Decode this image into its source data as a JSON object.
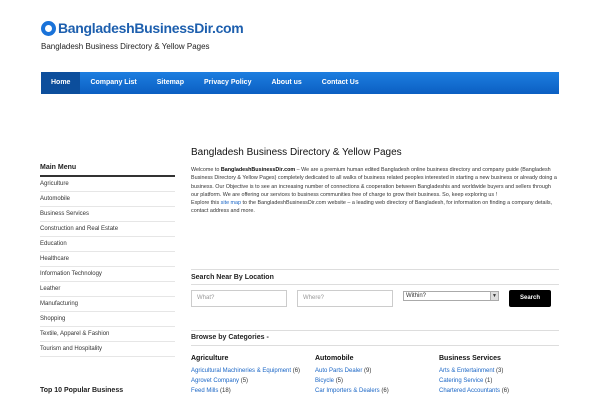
{
  "header": {
    "logo_text": "BangladeshBusinessDir.com",
    "tagline": "Bangladesh Business Directory & Yellow Pages"
  },
  "nav": [
    {
      "label": "Home",
      "active": true
    },
    {
      "label": "Company List"
    },
    {
      "label": "Sitemap"
    },
    {
      "label": "Privacy Policy"
    },
    {
      "label": "About us"
    },
    {
      "label": "Contact Us"
    }
  ],
  "sidebar": {
    "title": "Main Menu",
    "items": [
      "Agriculture",
      "Automobile",
      "Business Services",
      "Construction and Real Estate",
      "Education",
      "Healthcare",
      "Information Technology",
      "Leather",
      "Manufacturing",
      "Shopping",
      "Textile, Apparel & Fashion",
      "Tourism and Hospitality"
    ],
    "title2": "Top 10 Popular Business"
  },
  "main": {
    "title": "Bangladesh Business Directory & Yellow Pages",
    "intro": {
      "p1_a": "Welcome to ",
      "p1_b": "BangladeshBusinessDir.com",
      "p1_c": " – We are a premium human edited Bangladesh online business directory and company guide (Bangladesh Business Directory & Yellow Pages) completely dedicated to all walks of business related peoples interested in starting a new business or already doing a business. Our Objective is to see an increasing number of connections & cooperation between Bangladeshis and worldwide buyers and sellers through our platform. We are offering our services to business communities free of charge to grow their business. So, keep exploring us !",
      "p2_a": "Explore this ",
      "p2_link": "site map",
      "p2_b": " to the BangladeshBusinessDir.com website – a leading web directory of Bangladesh, for information on finding a company details, contact address and more."
    }
  },
  "search": {
    "heading": "Search Near By Location",
    "what_placeholder": "What?",
    "where_placeholder": "Where?",
    "within_value": "Within?",
    "button": "Search"
  },
  "browse": {
    "heading": "Browse by Categories -",
    "columns": [
      {
        "title": "Agriculture",
        "links": [
          {
            "name": "Agricultural Machineries & Equipment",
            "count": "(6)"
          },
          {
            "name": "Agrovet Company",
            "count": "(5)"
          },
          {
            "name": "Feed Mills",
            "count": "(18)"
          }
        ]
      },
      {
        "title": "Automobile",
        "links": [
          {
            "name": "Auto Parts Dealer",
            "count": "(9)"
          },
          {
            "name": "Bicycle",
            "count": "(5)"
          },
          {
            "name": "Car Importers & Dealers",
            "count": "(6)"
          }
        ]
      },
      {
        "title": "Business Services",
        "links": [
          {
            "name": "Arts & Entertainment",
            "count": "(3)"
          },
          {
            "name": "Catering Service",
            "count": "(1)"
          },
          {
            "name": "Chartered Accountants",
            "count": "(6)"
          }
        ]
      }
    ]
  },
  "colors": {
    "nav_blue": "#0b5fc2",
    "link_blue": "#1a66c6",
    "logo_blue": "#1d5fae"
  }
}
